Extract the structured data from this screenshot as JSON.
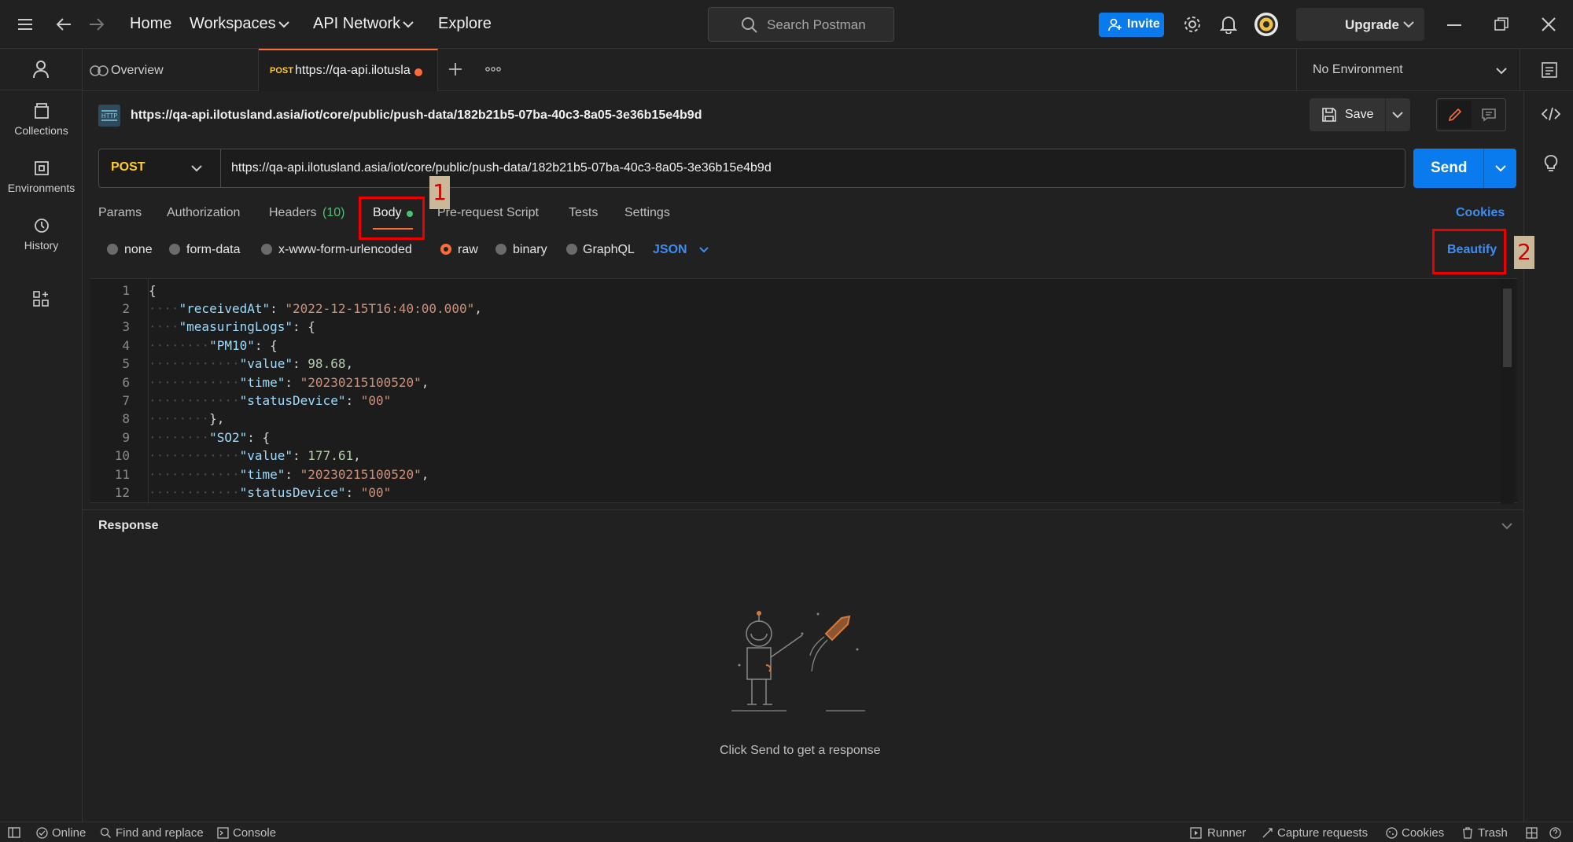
{
  "topbar": {
    "nav": [
      "Home",
      "Workspaces",
      "API Network",
      "Explore"
    ],
    "search_placeholder": "Search Postman",
    "invite": "Invite",
    "upgrade": "Upgrade"
  },
  "sidebar": {
    "items": [
      {
        "label": "Collections",
        "icon": "collections-icon"
      },
      {
        "label": "Environments",
        "icon": "environments-icon"
      },
      {
        "label": "History",
        "icon": "history-icon"
      }
    ]
  },
  "tabs": {
    "overview": "Overview",
    "active_method": "POST",
    "active_title": "https://qa-api.ilotusla",
    "environment": "No Environment"
  },
  "request": {
    "title_url": "https://qa-api.ilotusland.asia/iot/core/public/push-data/182b21b5-07ba-40c3-8a05-3e36b15e4b9d",
    "save": "Save",
    "method": "POST",
    "url": "https://qa-api.ilotusland.asia/iot/core/public/push-data/182b21b5-07ba-40c3-8a05-3e36b15e4b9d",
    "send": "Send",
    "tabs": [
      "Params",
      "Authorization",
      "Headers",
      "Body",
      "Pre-request Script",
      "Tests",
      "Settings"
    ],
    "headers_count": "(10)",
    "cookies": "Cookies",
    "body_modes": [
      "none",
      "form-data",
      "x-www-form-urlencoded",
      "raw",
      "binary",
      "GraphQL"
    ],
    "format": "JSON",
    "beautify": "Beautify"
  },
  "editor": {
    "line_numbers": [
      "1",
      "2",
      "3",
      "4",
      "5",
      "6",
      "7",
      "8",
      "9",
      "10",
      "11",
      "12"
    ],
    "keys": {
      "receivedAt": "\"receivedAt\"",
      "measuringLogs": "\"measuringLogs\"",
      "PM10": "\"PM10\"",
      "value": "\"value\"",
      "time": "\"time\"",
      "statusDevice": "\"statusDevice\"",
      "SO2": "\"SO2\""
    },
    "values": {
      "receivedAt": "\"2022-12-15T16:40:00.000\"",
      "pm10_value": "98.68",
      "pm10_time": "\"20230215100520\"",
      "pm10_status": "\"00\"",
      "so2_value": "177.61",
      "so2_time": "\"20230215100520\"",
      "so2_status": "\"00\""
    }
  },
  "response": {
    "title": "Response",
    "hint": "Click Send to get a response"
  },
  "annotations": [
    "1",
    "2"
  ],
  "statusbar": {
    "online": "Online",
    "find": "Find and replace",
    "console": "Console",
    "runner": "Runner",
    "capture": "Capture requests",
    "cookies": "Cookies",
    "trash": "Trash"
  },
  "colors": {
    "accent": "#097bed",
    "brand": "#ff6c37",
    "method_post": "#ffcb2f",
    "link": "#3d8df5"
  }
}
